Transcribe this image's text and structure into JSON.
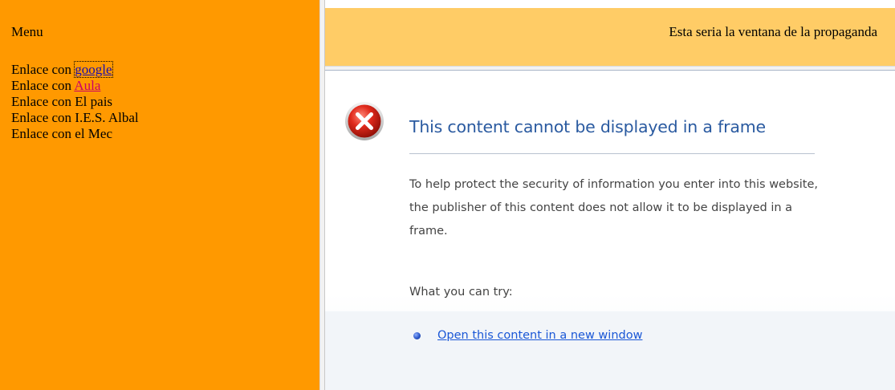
{
  "menu": {
    "title": "Menu",
    "items": [
      {
        "prefix": "Enlace con ",
        "link": "google"
      },
      {
        "prefix": "Enlace con ",
        "link": "Aula"
      },
      {
        "prefix": "Enlace con El pais",
        "link": ""
      },
      {
        "prefix": "Enlace con I.E.S. Albal",
        "link": ""
      },
      {
        "prefix": "Enlace con el Mec",
        "link": ""
      }
    ]
  },
  "ad_frame": {
    "text": "Esta seria la ventana de la propaganda"
  },
  "error_page": {
    "icon": "error-x-icon",
    "title": "This content cannot be displayed in a frame",
    "body": "To help protect the security of information you enter into this website, the publisher of this content does not allow it to be displayed in a frame.",
    "try_heading": "What you can try:",
    "try_items": [
      {
        "icon": "bullet-icon",
        "label": "Open this content in a new window"
      }
    ]
  },
  "colors": {
    "menu_bg": "#ff9900",
    "ad_bg": "#ffcc66",
    "error_title": "#2a5aa0",
    "link_blue": "#1a0dab",
    "link_red": "#cc0066"
  }
}
